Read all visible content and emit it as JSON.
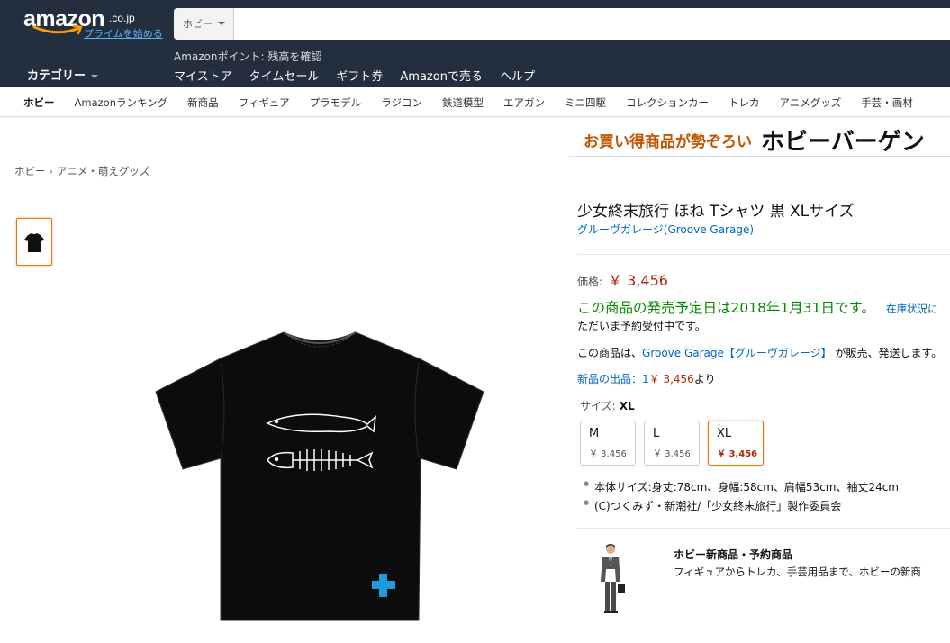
{
  "header": {
    "logo_text": "amazon",
    "logo_tld": ".co.jp",
    "prime_link": "プライムを始める",
    "search_dept": "ホビー",
    "search_value": "",
    "category_label": "カテゴリー",
    "points_text": "Amazonポイント: 残高を確認",
    "nav_links": [
      "マイストア",
      "タイムセール",
      "ギフト券",
      "Amazonで売る",
      "ヘルプ"
    ]
  },
  "subnav": {
    "items": [
      "ホビー",
      "Amazonランキング",
      "新商品",
      "フィギュア",
      "プラモデル",
      "ラジコン",
      "鉄道模型",
      "エアガン",
      "ミニ四駆",
      "コレクションカー",
      "トレカ",
      "アニメグッズ",
      "手芸・画材"
    ]
  },
  "banner": {
    "tagline": "お買い得商品が勢ぞろい",
    "headline": "ホビーバーゲン"
  },
  "breadcrumb": {
    "root": "ホビー",
    "separator": "›",
    "current": "アニメ・萌えグッズ"
  },
  "product": {
    "title": "少女終末旅行 ほね Tシャツ 黒 XLサイズ",
    "brand": "グルーヴガレージ(Groove Garage)",
    "price_label": "価格:",
    "price": "￥ 3,456",
    "release_text": "この商品の発売予定日は2018年1月31日です。",
    "stock_link": "在庫状況に",
    "preorder_text": "ただいま予約受付中です。",
    "seller_prefix": "この商品は、",
    "seller_link": "Groove Garage【グルーヴガレージ】",
    "seller_suffix": " が販売、発送します。",
    "new_offers_link": "新品の出品：1",
    "new_offers_price": "￥ 3,456",
    "new_offers_suffix": "より",
    "size_label": "サイズ:",
    "size_selected": "XL",
    "sizes": [
      {
        "name": "M",
        "price": "￥ 3,456"
      },
      {
        "name": "L",
        "price": "￥ 3,456"
      },
      {
        "name": "XL",
        "price": "￥ 3,456"
      }
    ],
    "bullets": [
      "本体サイズ:身丈:78cm、身幅:58cm、肩幅53cm、袖丈24cm",
      "(C)つくみず・新潮社/「少女終末旅行」製作委員会"
    ]
  },
  "promo": {
    "title": "ホビー新商品・予約商品",
    "description": "フィギュアからトレカ、手芸用品まで、ホビーの新商"
  },
  "colors": {
    "header_bg": "#232f3e",
    "price": "#b12704",
    "link": "#0066c0",
    "release": "#008a00",
    "selected_border": "#e77600",
    "banner_orange": "#c45500",
    "tshirt_cross": "#1e9ae0"
  }
}
